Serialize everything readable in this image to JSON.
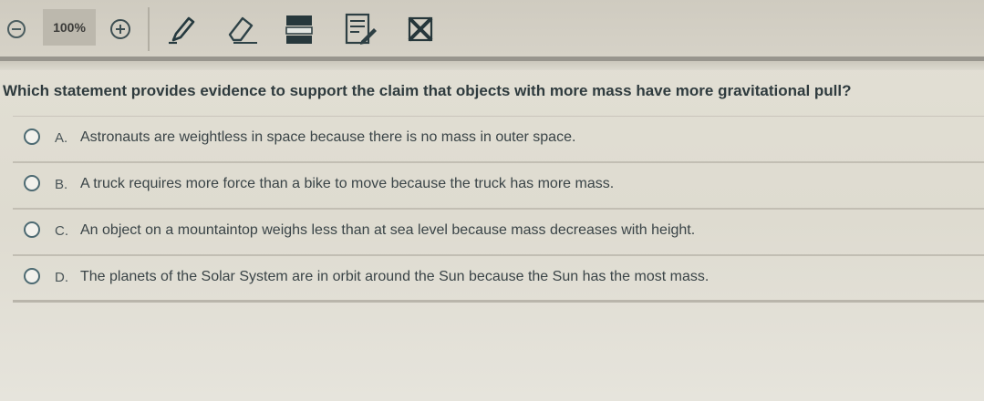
{
  "toolbar": {
    "zoom_level": "100%",
    "tools": [
      {
        "icon": "zoom-out-icon"
      },
      {
        "icon": "zoom-in-icon"
      },
      {
        "icon": "pencil-icon"
      },
      {
        "icon": "eraser-icon"
      },
      {
        "icon": "line-reader-icon"
      },
      {
        "icon": "notepad-icon"
      },
      {
        "icon": "answer-eliminator-icon"
      }
    ]
  },
  "question": {
    "text": "Which statement provides evidence to support the claim that objects with more mass have more gravitational pull?",
    "choices": [
      {
        "letter": "A.",
        "text": "Astronauts are weightless in space because there is no mass in outer space."
      },
      {
        "letter": "B.",
        "text": "A truck requires more force than a bike to move because the truck has more mass."
      },
      {
        "letter": "C.",
        "text": "An object on a mountaintop weighs less than at sea level because mass decreases with height."
      },
      {
        "letter": "D.",
        "text": "The planets of the Solar System are in orbit around the Sun because the Sun has the most mass."
      }
    ]
  },
  "colors": {
    "toolbar_bg": "#d2cec3",
    "icon_color": "#3d5056",
    "radio_border": "#4d6a72"
  }
}
